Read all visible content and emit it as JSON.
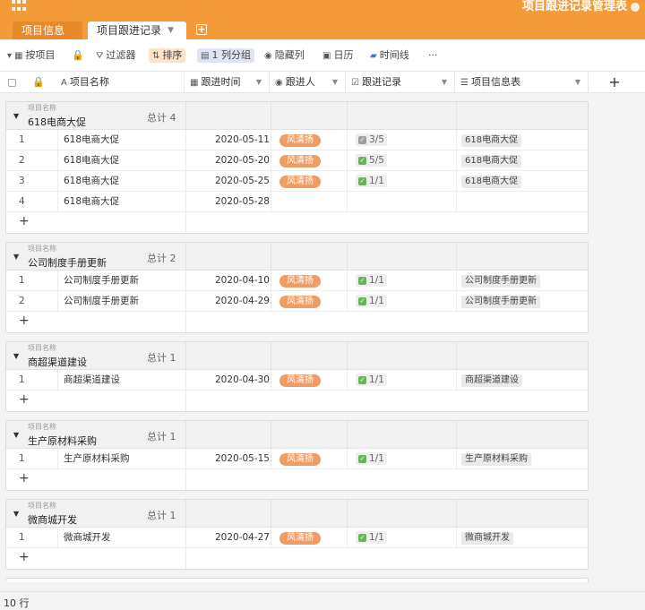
{
  "app_title": "项目跟进记录管理表",
  "tabs": [
    {
      "label": "项目信息表"
    },
    {
      "label": "项目跟进记录"
    }
  ],
  "toolbar": {
    "field": "按项目",
    "filter": "过滤器",
    "sort": "排序",
    "group": "1 列分组",
    "hide": "隐藏列",
    "calendar": "日历",
    "timeline": "时间线",
    "more": "···"
  },
  "columns": {
    "name": "项目名称",
    "time": "跟进时间",
    "person": "跟进人",
    "record": "跟进记录",
    "info": "项目信息表"
  },
  "group_label": "项目名称",
  "groups": [
    {
      "name": "618电商大促",
      "total": "总计 4",
      "rows": [
        {
          "n": "1",
          "name": "618电商大促",
          "date": "2020-05-11",
          "person": "风清扬",
          "rec": "3/5",
          "info": "618电商大促"
        },
        {
          "n": "2",
          "name": "618电商大促",
          "date": "2020-05-20",
          "person": "风清扬",
          "rec": "5/5",
          "info": "618电商大促"
        },
        {
          "n": "3",
          "name": "618电商大促",
          "date": "2020-05-25",
          "person": "风清扬",
          "rec": "1/1",
          "info": "618电商大促"
        },
        {
          "n": "4",
          "name": "618电商大促",
          "date": "2020-05-28",
          "person": "",
          "rec": "",
          "info": ""
        }
      ]
    },
    {
      "name": "公司制度手册更新",
      "total": "总计 2",
      "rows": [
        {
          "n": "1",
          "name": "公司制度手册更新",
          "date": "2020-04-10",
          "person": "风清扬",
          "rec": "1/1",
          "info": "公司制度手册更新"
        },
        {
          "n": "2",
          "name": "公司制度手册更新",
          "date": "2020-04-29",
          "person": "风清扬",
          "rec": "1/1",
          "info": "公司制度手册更新"
        }
      ]
    },
    {
      "name": "商超渠道建设",
      "total": "总计 1",
      "rows": [
        {
          "n": "1",
          "name": "商超渠道建设",
          "date": "2020-04-30",
          "person": "风清扬",
          "rec": "1/1",
          "info": "商超渠道建设"
        }
      ]
    },
    {
      "name": "生产原材料采购",
      "total": "总计 1",
      "rows": [
        {
          "n": "1",
          "name": "生产原材料采购",
          "date": "2020-05-15",
          "person": "风清扬",
          "rec": "1/1",
          "info": "生产原材料采购"
        }
      ]
    },
    {
      "name": "微商城开发",
      "total": "总计 1",
      "rows": [
        {
          "n": "1",
          "name": "微商城开发",
          "date": "2020-04-27",
          "person": "风清扬",
          "rec": "1/1",
          "info": "微商城开发"
        }
      ]
    }
  ],
  "add_row": "+",
  "row_count": "10 行",
  "colors": {
    "accent": "#f39a39",
    "tag": "#ef9d63",
    "check": "#69b35a"
  }
}
